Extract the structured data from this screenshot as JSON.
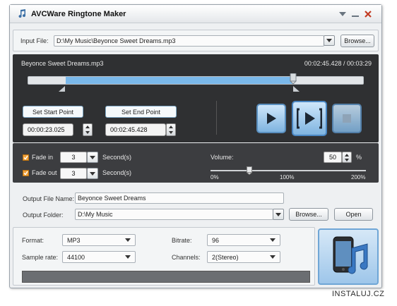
{
  "window": {
    "title": "AVCWare Ringtone Maker"
  },
  "input": {
    "label": "Input File:",
    "value": "D:\\My Music\\Beyonce Sweet Dreams.mp3",
    "browse_label": "Browse..."
  },
  "player": {
    "track_name": "Beyonce Sweet Dreams.mp3",
    "time_display": "00:02:45.428 / 00:03:29",
    "selection_start_fraction": 0.111,
    "selection_end_fraction": 0.791,
    "set_start_label": "Set Start Point",
    "set_end_label": "Set End Point",
    "start_time": "00:00:23.025",
    "end_time": "00:02:45.428"
  },
  "effects": {
    "fade_in_label": "Fade in",
    "fade_in_value": "3",
    "fade_out_label": "Fade out",
    "fade_out_value": "3",
    "seconds_label": "Second(s)",
    "volume_label": "Volume:",
    "volume_value": "50",
    "volume_unit": "%",
    "volume_fraction": 0.25,
    "scale": [
      "0%",
      "100%",
      "200%"
    ]
  },
  "output": {
    "name_label": "Output File Name:",
    "name_value": "Beyonce Sweet Dreams",
    "folder_label": "Output Folder:",
    "folder_value": "D:\\My Music",
    "browse_label": "Browse...",
    "open_label": "Open"
  },
  "settings": {
    "format_label": "Format:",
    "format_value": "MP3",
    "bitrate_label": "Bitrate:",
    "bitrate_value": "96",
    "samplerate_label": "Sample rate:",
    "samplerate_value": "44100",
    "channels_label": "Channels:",
    "channels_value": "2(Stereo)"
  },
  "watermark": "INSTALUJ.CZ",
  "colors": {
    "accent": "#7ab8ea",
    "dark_panel": "#2f3032",
    "checkbox": "#f2a23a"
  }
}
